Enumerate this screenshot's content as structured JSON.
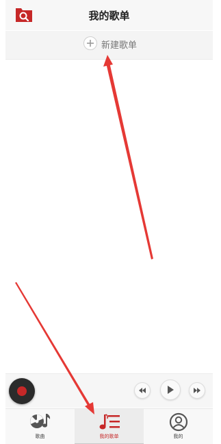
{
  "header": {
    "title": "我的歌单",
    "search_icon": "search-folder-icon"
  },
  "new_playlist": {
    "label": "新建歌单",
    "icon": "plus-icon"
  },
  "player": {
    "cover_icon": "vinyl-disc-icon",
    "prev_icon": "rewind-icon",
    "play_icon": "play-icon",
    "next_icon": "fast-forward-icon"
  },
  "bottom_nav": {
    "tabs": [
      {
        "label": "歌曲",
        "icon": "disc-music-note-icon",
        "active": false
      },
      {
        "label": "我的歌单",
        "icon": "playlist-icon",
        "active": true
      },
      {
        "label": "我的",
        "icon": "user-icon",
        "active": false
      }
    ]
  },
  "colors": {
    "accent": "#c62828",
    "annotation_arrow": "#e53935"
  }
}
